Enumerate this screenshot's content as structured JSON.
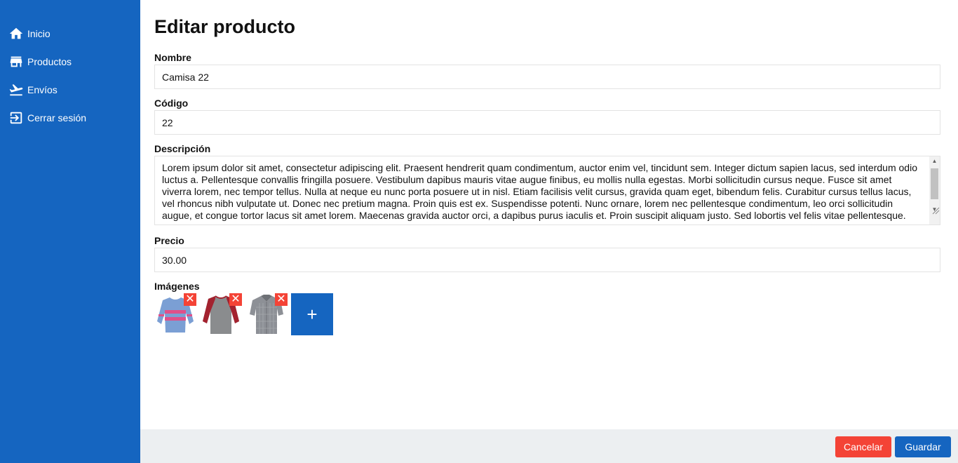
{
  "sidebar": {
    "items": [
      {
        "label": "Inicio",
        "icon": "home-icon"
      },
      {
        "label": "Productos",
        "icon": "store-icon"
      },
      {
        "label": "Envíos",
        "icon": "plane-departure-icon"
      },
      {
        "label": "Cerrar sesión",
        "icon": "logout-icon"
      }
    ],
    "background": "#1565c0"
  },
  "main": {
    "title": "Editar producto",
    "fields": {
      "name": {
        "label": "Nombre",
        "value": "Camisa 22"
      },
      "code": {
        "label": "Código",
        "value": "22"
      },
      "description": {
        "label": "Descripción",
        "value": "Lorem ipsum dolor sit amet, consectetur adipiscing elit. Praesent hendrerit quam condimentum, auctor enim vel, tincidunt sem. Integer dictum sapien lacus, sed interdum odio luctus a. Pellentesque convallis fringilla posuere. Vestibulum dapibus mauris vitae augue finibus, eu mollis nulla egestas. Morbi sollicitudin cursus neque. Fusce sit amet viverra lorem, nec tempor tellus. Nulla at neque eu nunc porta posuere ut in nisl. Etiam facilisis velit cursus, gravida quam eget, bibendum felis. Curabitur cursus tellus lacus, vel rhoncus nibh vulputate ut. Donec nec pretium magna. Proin quis est ex. Suspendisse potenti. Nunc ornare, lorem nec pellentesque condimentum, leo orci sollicitudin augue, et congue tortor lacus sit amet lorem. Maecenas gravida auctor orci, a dapibus purus iaculis et. Proin suscipit aliquam justo. Sed lobortis vel felis vitae pellentesque."
      },
      "price": {
        "label": "Precio",
        "value": "30.00"
      }
    },
    "images": {
      "label": "Imágenes",
      "items": [
        {
          "name": "striped-shirt",
          "remove_icon": "✕"
        },
        {
          "name": "raglan-shirt",
          "remove_icon": "✕"
        },
        {
          "name": "plaid-shirt",
          "remove_icon": "✕"
        }
      ],
      "add_label": "+"
    }
  },
  "footer": {
    "cancel_label": "Cancelar",
    "save_label": "Guardar",
    "cancel_color": "#f44336",
    "save_color": "#1565c0"
  }
}
